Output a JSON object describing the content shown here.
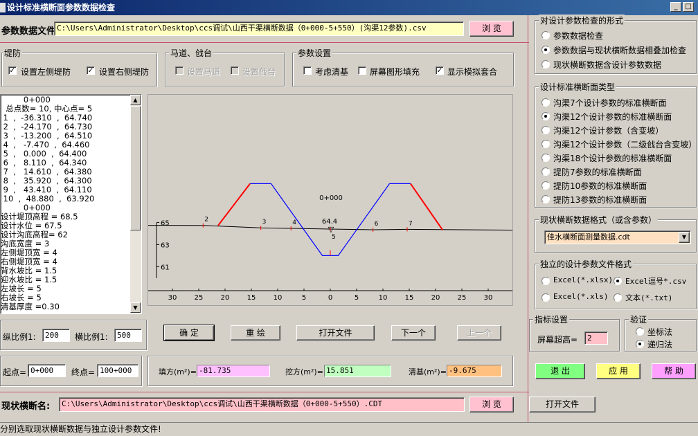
{
  "window": {
    "title": "设计标准横断面参数数据检查",
    "min_glyph": "_",
    "max_glyph": "□",
    "close_glyph": "×"
  },
  "param_file": {
    "label": "参数数据文件",
    "path": "C:\\Users\\Administrator\\Desktop\\ccs调试\\山西干渠横断数据（0+000-5+550）(沟渠12参数).csv",
    "browse": "浏 览"
  },
  "dike": {
    "legend": "堤防",
    "left": "设置左侧堤防",
    "right": "设置右侧堤防",
    "left_checked": "✓",
    "right_checked": "✓"
  },
  "berm": {
    "legend": "马道、戗台",
    "road": "设置马道",
    "platform": "设置戗台"
  },
  "params": {
    "legend": "参数设置",
    "clearing": "考虑清基",
    "fill": "屏幕图形填充",
    "overlay": "显示模拟套合",
    "overlay_checked": "✓"
  },
  "data_list": [
    "         0+000",
    "  总点数= 10, 中心点= 5",
    " 1  ,  -36.310  ,  64.740",
    " 2  ,  -24.170  ,  64.730",
    " 3  ,  -13.200  ,  64.510",
    " 4  ,   -7.470  ,  64.460",
    " 5  ,   0.000  ,  64.400",
    " 6  ,   8.110  ,  64.340",
    " 7  ,   14.610  ,  64.380",
    " 8  ,   35.920  ,  64.300",
    " 9  ,   43.410  ,  64.110",
    " 10  ,  48.880  ,  63.920",
    "         0+000",
    "设计堤顶高程 = 68.5",
    "设计水位 = 67.5",
    "设计沟底高程= 62",
    "沟底宽度 = 3",
    "左侧堤顶宽 = 4",
    "右侧堤顶宽 = 4",
    "背水坡比 = 1.5",
    "迎水坡比 = 1.5",
    "左坡长 = 5",
    "右坡长 = 5",
    "清基厚度 =0.30"
  ],
  "scroll": {
    "up": "▲",
    "down": "▼"
  },
  "plot": {
    "station": "0+000",
    "center_elev": "64.4",
    "marker": "▽",
    "y_ticks": [
      "65",
      "63",
      "61"
    ],
    "x_ticks": [
      "5",
      "30",
      "25",
      "20",
      "15",
      "10",
      "5",
      "0",
      "5",
      "10",
      "15",
      "20",
      "25",
      "30",
      "3"
    ],
    "point_labels": [
      "2",
      "3",
      "4",
      "5",
      "6",
      "7"
    ],
    "ground_color": "#000000",
    "design_color": "#0000ff",
    "dike_color": "#ff0000"
  },
  "scale": {
    "v_label": "纵比例1:",
    "v_value": "200",
    "h_label": "横比例1:",
    "h_value": "500"
  },
  "buttons": {
    "ok": "确 定",
    "redraw": "重 绘",
    "open": "打开文件",
    "next": "下一个",
    "prev": "上一个"
  },
  "range": {
    "start_label": "起点=",
    "start": "0+000",
    "end_label": "终点=",
    "end": "100+000"
  },
  "areas": {
    "fill_label": "填方(m²)=",
    "fill": "-81.735",
    "fill_color": "#ffc0ff",
    "cut_label": "挖方(m²)=",
    "cut": "15.851",
    "cut_color": "#c0ffc0",
    "clear_label": "清基(m²)=",
    "clear": "-9.675",
    "clear_color": "#ffc080"
  },
  "current": {
    "label": "现状横断名:",
    "path": "C:\\Users\\Administrator\\Desktop\\ccs调试\\山西干渠横断数据（0+000-5+550）.CDT",
    "browse": "浏 览",
    "open": "打开文件"
  },
  "status": "分别选取现状横断数据与独立设计参数文件!",
  "check_form": {
    "legend": "对设计参数检查的形式",
    "options": [
      "参数数据检查",
      "参数数据与现状横断数据相叠加检查",
      "现状横断数据含设计参数数据"
    ],
    "selected": 1
  },
  "section_type": {
    "legend": "设计标准横断面类型",
    "options": [
      "沟渠7个设计参数的标准横断面",
      "沟渠12个设计参数的标准横断面",
      "沟渠12个设计参数（含变坡）",
      "沟渠12个设计参数（二级戗台含变坡）",
      "沟渠18个设计参数的标准横断面",
      "提防7参数的标准横断面",
      "提防10参数的标准横断面",
      "提防13参数的标准横断面"
    ],
    "selected": 1
  },
  "data_format": {
    "legend": "现状横断数据格式（或含参数）",
    "value": "佳水横断面测量数据.cdt",
    "arrow": "▼"
  },
  "file_format": {
    "legend": "独立的设计参数文件格式",
    "options": [
      "Excel(*.xlsx)",
      "Excel逗号*.csv",
      "Excel(*.xls)",
      "文本(*.txt)"
    ],
    "selected": 1
  },
  "index": {
    "legend": "指标设置",
    "label": "屏幕超高=",
    "value": "2"
  },
  "verify": {
    "legend": "验证",
    "options": [
      "坐标法",
      "递归法"
    ],
    "selected": 1
  },
  "actions": {
    "exit": "退 出",
    "apply": "应 用",
    "help": "帮 助"
  }
}
